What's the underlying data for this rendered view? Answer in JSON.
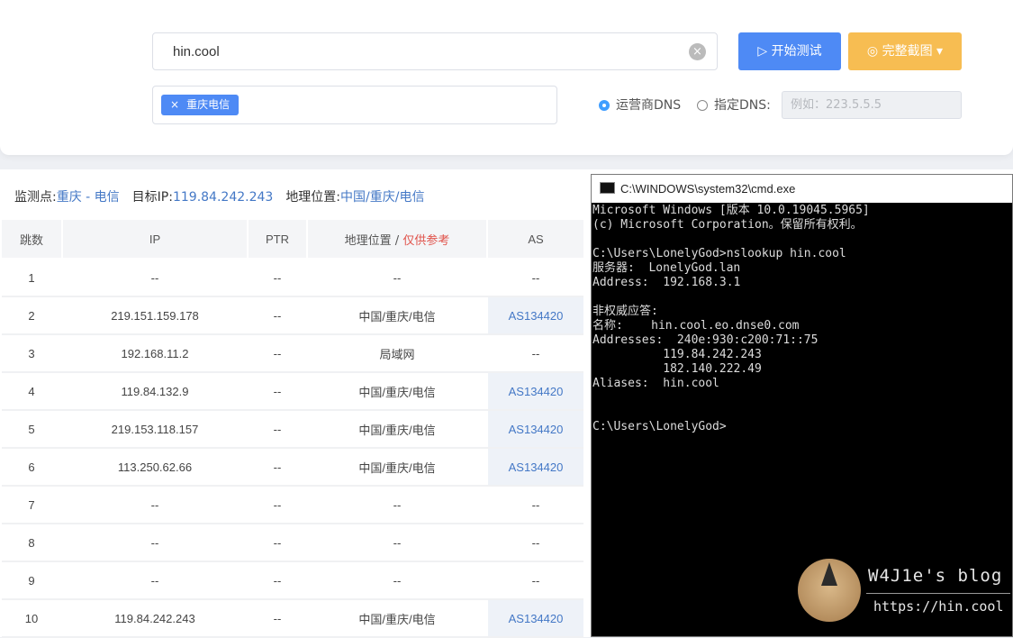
{
  "search": {
    "value": "hin.cool",
    "clear_icon": "×"
  },
  "buttons": {
    "start": "▷ 开始测试",
    "screenshot": "◎ 完整截图 ▾"
  },
  "tag": {
    "remove": "×",
    "label": "重庆电信"
  },
  "dns": {
    "isp_label": "运营商DNS",
    "custom_label": "指定DNS:",
    "placeholder": "例如：223.5.5.5",
    "selected": "isp"
  },
  "info": {
    "monitor_label": "监测点:",
    "monitor_value": "重庆 - 电信",
    "target_label": "目标IP:",
    "target_value": "119.84.242.243",
    "geo_label": "地理位置:",
    "geo_value": "中国/重庆/电信"
  },
  "table": {
    "headers": {
      "hop": "跳数",
      "ip": "IP",
      "ptr": "PTR",
      "geo": "地理位置 / ",
      "geo_note": "仅供参考",
      "as": "AS"
    },
    "rows": [
      {
        "hop": "1",
        "ip": "--",
        "ptr": "--",
        "geo": "--",
        "as": "--"
      },
      {
        "hop": "2",
        "ip": "219.151.159.178",
        "ptr": "--",
        "geo": "中国/重庆/电信",
        "as": "AS134420"
      },
      {
        "hop": "3",
        "ip": "192.168.11.2",
        "ptr": "--",
        "geo": "局域网",
        "as": "--"
      },
      {
        "hop": "4",
        "ip": "119.84.132.9",
        "ptr": "--",
        "geo": "中国/重庆/电信",
        "as": "AS134420"
      },
      {
        "hop": "5",
        "ip": "219.153.118.157",
        "ptr": "--",
        "geo": "中国/重庆/电信",
        "as": "AS134420"
      },
      {
        "hop": "6",
        "ip": "113.250.62.66",
        "ptr": "--",
        "geo": "中国/重庆/电信",
        "as": "AS134420"
      },
      {
        "hop": "7",
        "ip": "--",
        "ptr": "--",
        "geo": "--",
        "as": "--"
      },
      {
        "hop": "8",
        "ip": "--",
        "ptr": "--",
        "geo": "--",
        "as": "--"
      },
      {
        "hop": "9",
        "ip": "--",
        "ptr": "--",
        "geo": "--",
        "as": "--"
      },
      {
        "hop": "10",
        "ip": "119.84.242.243",
        "ptr": "--",
        "geo": "中国/重庆/电信",
        "as": "AS134420"
      }
    ]
  },
  "cmd": {
    "title": "C:\\WINDOWS\\system32\\cmd.exe",
    "lines": [
      "Microsoft Windows [版本 10.0.19045.5965]",
      "(c) Microsoft Corporation。保留所有权利。",
      "",
      "C:\\Users\\LonelyGod>nslookup hin.cool",
      "服务器:  LonelyGod.lan",
      "Address:  192.168.3.1",
      "",
      "非权威应答:",
      "名称:    hin.cool.eo.dnse0.com",
      "Addresses:  240e:930:c200:71::75",
      "          119.84.242.243",
      "          182.140.222.49",
      "Aliases:  hin.cool",
      "",
      "",
      "C:\\Users\\LonelyGod>"
    ]
  },
  "watermark": {
    "name": "W4J1e's blog",
    "url": "https://hin.cool"
  }
}
